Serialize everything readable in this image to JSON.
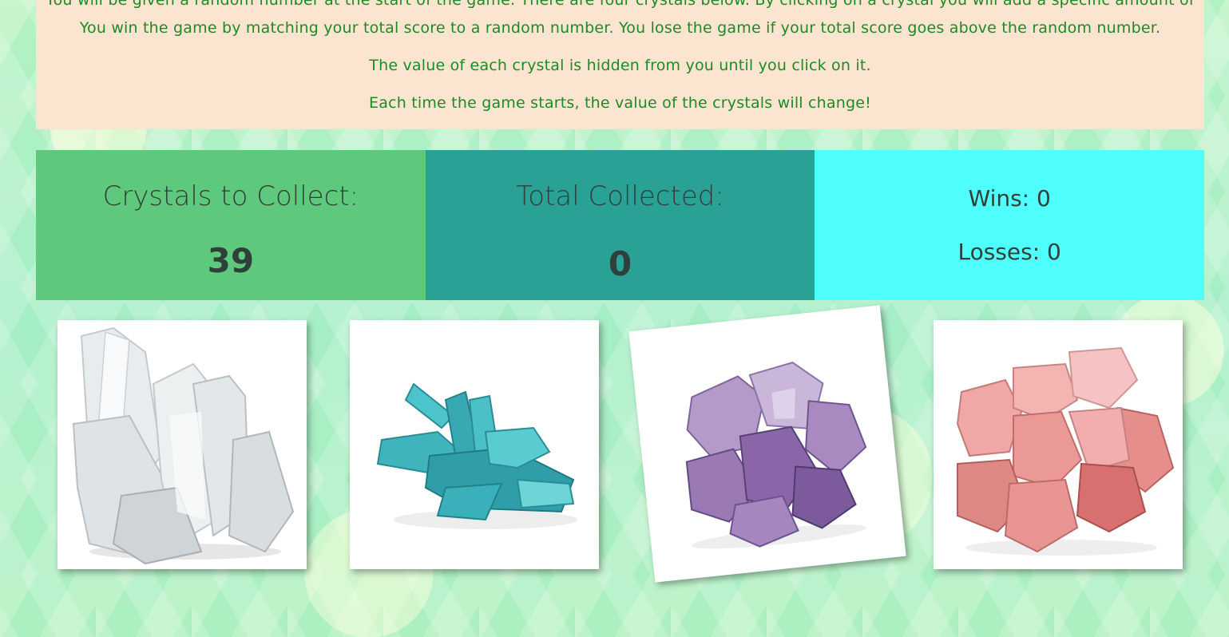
{
  "instructions": {
    "line0": "You will be given a random number at the start of the game. There are four crystals below. By clicking on a crystal you will add a specific amount of points to your total score.",
    "line1": "You win the game by matching your total score to a random number. You lose the game if your total score goes above the random number.",
    "line2": "The value of each crystal is hidden from you until you click on it.",
    "line3": "Each time the game starts, the value of the crystals will change!"
  },
  "scoreboard": {
    "target_label": "Crystals to Collect:",
    "target_value": "39",
    "total_label": "Total Collected:",
    "total_value": "0",
    "wins_label": "Wins: 0",
    "losses_label": "Losses: 0"
  },
  "crystals": [
    {
      "name": "clear quartz",
      "icon": "clear-quartz-crystal-icon"
    },
    {
      "name": "aqua aura",
      "icon": "aqua-crystal-icon"
    },
    {
      "name": "amethyst",
      "icon": "amethyst-crystal-icon"
    },
    {
      "name": "rose quartz",
      "icon": "rose-quartz-crystal-icon"
    }
  ],
  "colors": {
    "instructions_bg": "#fbe4d0",
    "instructions_text": "#1c8b25",
    "target_panel": "#5ec97d",
    "total_panel": "#2aa195",
    "record_panel": "#4ffffb"
  }
}
